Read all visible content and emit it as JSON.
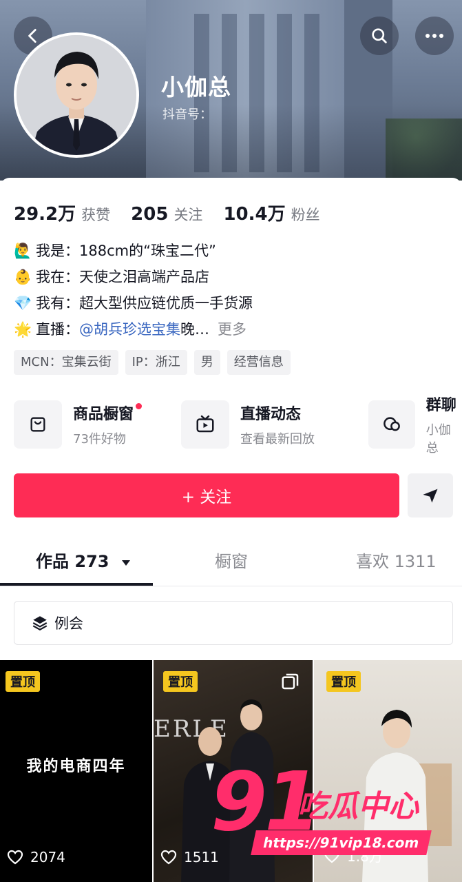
{
  "header": {
    "nickname": "小伽总",
    "douyin_id_label": "抖音号："
  },
  "stats": [
    {
      "num": "29.2万",
      "label": "获赞"
    },
    {
      "num": "205",
      "label": "关注"
    },
    {
      "num": "10.4万",
      "label": "粉丝"
    }
  ],
  "bio": {
    "line1": {
      "emoji": "🙋‍♂️",
      "text": "我是：188cm的“珠宝二代”"
    },
    "line2": {
      "emoji": "👶",
      "text": "我在：天使之泪高端产品店"
    },
    "line3": {
      "emoji": "💎",
      "text": "我有：超大型供应链优质一手货源"
    },
    "line4": {
      "emoji": "🌟",
      "prefix": "直播：",
      "link": "@胡兵珍选宝集",
      "suffix": " 晚…",
      "more": "更多"
    }
  },
  "tags": [
    "MCN：宝集云街",
    "IP：浙江",
    "男",
    "经营信息"
  ],
  "services": [
    {
      "title": "商品橱窗",
      "sub": "73件好物",
      "icon": "shopping-bag-icon"
    },
    {
      "title": "直播动态",
      "sub": "查看最新回放",
      "icon": "tv-icon"
    },
    {
      "title": "群聊",
      "sub": "小伽总",
      "icon": "chat-icon"
    }
  ],
  "follow_label": "+ 关注",
  "tabs": {
    "works": "作品 273",
    "showcase": "橱窗",
    "likes": "喜欢 1311"
  },
  "collection_label": "例会",
  "thumbs": [
    {
      "pin": "置顶",
      "caption": "我的电商四年",
      "likes": "2074"
    },
    {
      "pin": "置顶",
      "likes": "1511",
      "sign": "ERLE"
    },
    {
      "pin": "置顶",
      "likes": "1.8万"
    }
  ],
  "watermark": {
    "number": "91",
    "text": "吃瓜中心",
    "url": "https://91vip18.com"
  },
  "colors": {
    "accent": "#fe2c55",
    "pin": "#f4c61f",
    "link": "#3a67c0"
  }
}
